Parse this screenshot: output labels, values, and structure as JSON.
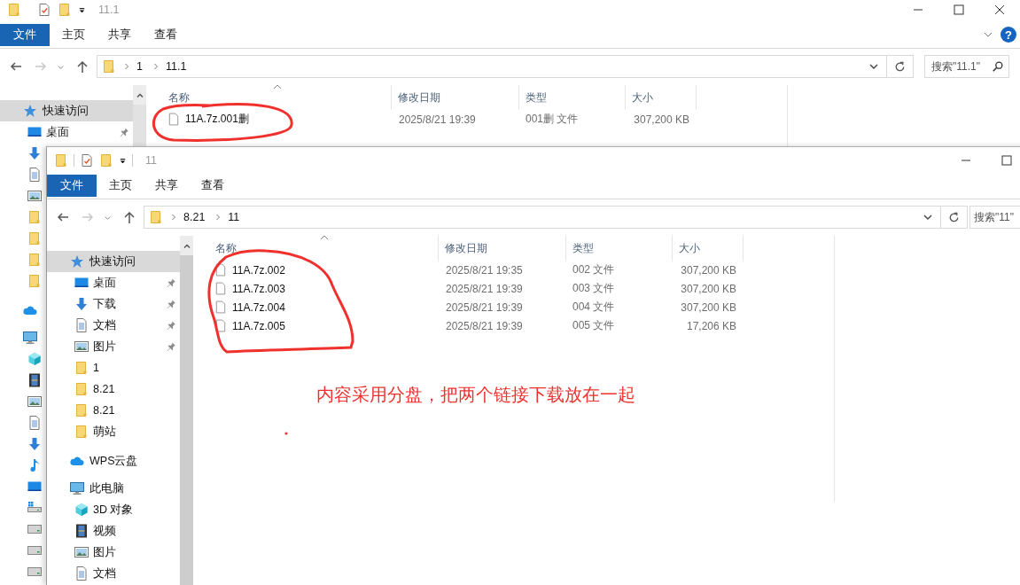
{
  "windows": [
    {
      "title": "11.1",
      "help": "?",
      "ribbon_tabs": [
        {
          "label": "文件",
          "kind": "file_menu"
        },
        {
          "label": "主页",
          "kind": "tab"
        },
        {
          "label": "共享",
          "kind": "tab"
        },
        {
          "label": "查看",
          "kind": "tab"
        }
      ],
      "breadcrumb": [
        "1",
        "11.1"
      ],
      "search": {
        "placeholder": "搜索\"11.1\""
      },
      "sidebar": {
        "items": [
          {
            "kind": "quick_access",
            "label": "快速访问",
            "selected": true
          },
          {
            "kind": "desktop",
            "label": "桌面",
            "pinned": true,
            "selected": false
          },
          {
            "kind": "download"
          },
          {
            "kind": "document"
          },
          {
            "kind": "pictures"
          },
          {
            "kind": "folder"
          },
          {
            "kind": "folder"
          },
          {
            "kind": "folder"
          },
          {
            "kind": "folder"
          },
          {
            "kind": "cloud"
          },
          {
            "kind": "pc"
          },
          {
            "kind": "objects"
          },
          {
            "kind": "video"
          },
          {
            "kind": "pictures"
          },
          {
            "kind": "document"
          },
          {
            "kind": "download"
          },
          {
            "kind": "music"
          },
          {
            "kind": "desktop"
          },
          {
            "kind": "system_drive"
          },
          {
            "kind": "drive"
          },
          {
            "kind": "drive"
          },
          {
            "kind": "drive"
          }
        ]
      },
      "columns": [
        "名称",
        "修改日期",
        "类型",
        "大小"
      ],
      "files": [
        {
          "name": "11A.7z.001删",
          "modified": "2025/8/21 19:39",
          "type": "001删 文件",
          "size": "307,200 KB"
        }
      ]
    },
    {
      "title": "11",
      "ribbon_tabs": [
        {
          "label": "文件",
          "kind": "file_menu"
        },
        {
          "label": "主页",
          "kind": "tab"
        },
        {
          "label": "共享",
          "kind": "tab"
        },
        {
          "label": "查看",
          "kind": "tab"
        }
      ],
      "breadcrumb": [
        "8.21",
        "11"
      ],
      "search": {
        "placeholder": "搜索\"11\""
      },
      "sidebar": {
        "items": [
          {
            "kind": "quick_access",
            "label": "快速访问",
            "selected": true
          },
          {
            "kind": "desktop",
            "label": "桌面",
            "pinned": true,
            "selected": false
          },
          {
            "kind": "download",
            "label": "下载",
            "pinned": true,
            "selected": false
          },
          {
            "kind": "document",
            "label": "文档",
            "pinned": true,
            "selected": false
          },
          {
            "kind": "pictures",
            "label": "图片",
            "pinned": true,
            "selected": false
          },
          {
            "kind": "folder",
            "label": "1",
            "pinned": false,
            "selected": false
          },
          {
            "kind": "folder",
            "label": "8.21",
            "pinned": false,
            "selected": false
          },
          {
            "kind": "folder",
            "label": "8.21",
            "pinned": false,
            "selected": false
          },
          {
            "kind": "folder",
            "label": "萌站",
            "pinned": false,
            "selected": false
          },
          {
            "kind": "cloud",
            "label": "WPS云盘",
            "selected": false
          },
          {
            "kind": "pc",
            "label": "此电脑",
            "selected": false
          },
          {
            "kind": "objects",
            "label": "3D 对象",
            "selected": false
          },
          {
            "kind": "video",
            "label": "视频",
            "selected": false
          },
          {
            "kind": "pictures",
            "label": "图片",
            "selected": false
          },
          {
            "kind": "document",
            "label": "文档",
            "selected": false
          }
        ]
      },
      "columns": [
        "名称",
        "修改日期",
        "类型",
        "大小"
      ],
      "files": [
        {
          "name": "11A.7z.002",
          "modified": "2025/8/21 19:35",
          "type": "002 文件",
          "size": "307,200 KB"
        },
        {
          "name": "11A.7z.003",
          "modified": "2025/8/21 19:39",
          "type": "003 文件",
          "size": "307,200 KB"
        },
        {
          "name": "11A.7z.004",
          "modified": "2025/8/21 19:39",
          "type": "004 文件",
          "size": "307,200 KB"
        },
        {
          "name": "11A.7z.005",
          "modified": "2025/8/21 19:39",
          "type": "005 文件",
          "size": "17,206 KB"
        }
      ]
    }
  ],
  "annotation": {
    "text": "内容采用分盘，把两个链接下载放在一起"
  }
}
